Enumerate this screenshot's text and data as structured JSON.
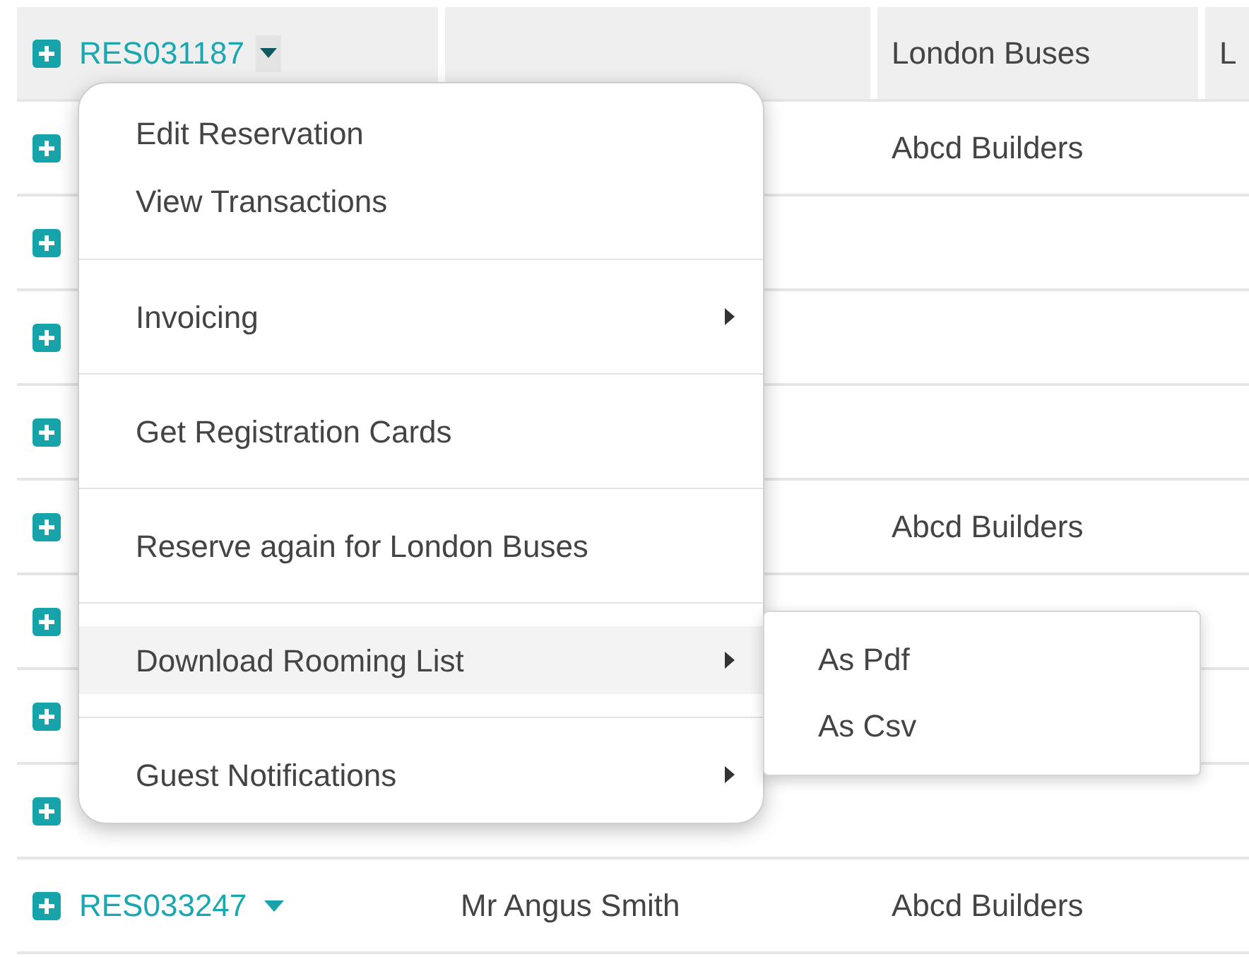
{
  "table": {
    "rows": [
      {
        "selected": true,
        "reservation": {
          "number": "RES031187",
          "menu_open": true
        },
        "column_3": "London Buses",
        "column_4": "L"
      },
      {
        "selected": false,
        "column_3": "Abcd Builders"
      },
      {
        "selected": false
      },
      {
        "selected": false
      },
      {
        "selected": false
      },
      {
        "selected": false,
        "column_3": "Abcd Builders"
      },
      {
        "selected": false
      },
      {
        "selected": false
      },
      {
        "selected": false
      },
      {
        "selected": false,
        "reservation": {
          "number": "RES033247",
          "menu_open": false
        },
        "column_2": "Mr Angus Smith",
        "column_3": "Abcd Builders"
      }
    ]
  },
  "context_menu": {
    "groups": [
      {
        "items": [
          {
            "label": "Edit Reservation",
            "has_submenu": false,
            "selected": false
          },
          {
            "label": "View Transactions",
            "has_submenu": false,
            "selected": false
          }
        ]
      },
      {
        "items": [
          {
            "label": "Invoicing",
            "has_submenu": true,
            "selected": false
          }
        ]
      },
      {
        "items": [
          {
            "label": "Get Registration Cards",
            "has_submenu": false,
            "selected": false
          }
        ]
      },
      {
        "items": [
          {
            "label": "Reserve again for London Buses",
            "has_submenu": false,
            "selected": false
          }
        ]
      },
      {
        "items": [
          {
            "label": "Download Rooming List",
            "has_submenu": true,
            "selected": true
          }
        ]
      },
      {
        "items": [
          {
            "label": "Guest Notifications",
            "has_submenu": true,
            "selected": false
          }
        ]
      }
    ]
  },
  "submenu": {
    "items": [
      {
        "label": "As Pdf"
      },
      {
        "label": "As Csv"
      }
    ]
  }
}
